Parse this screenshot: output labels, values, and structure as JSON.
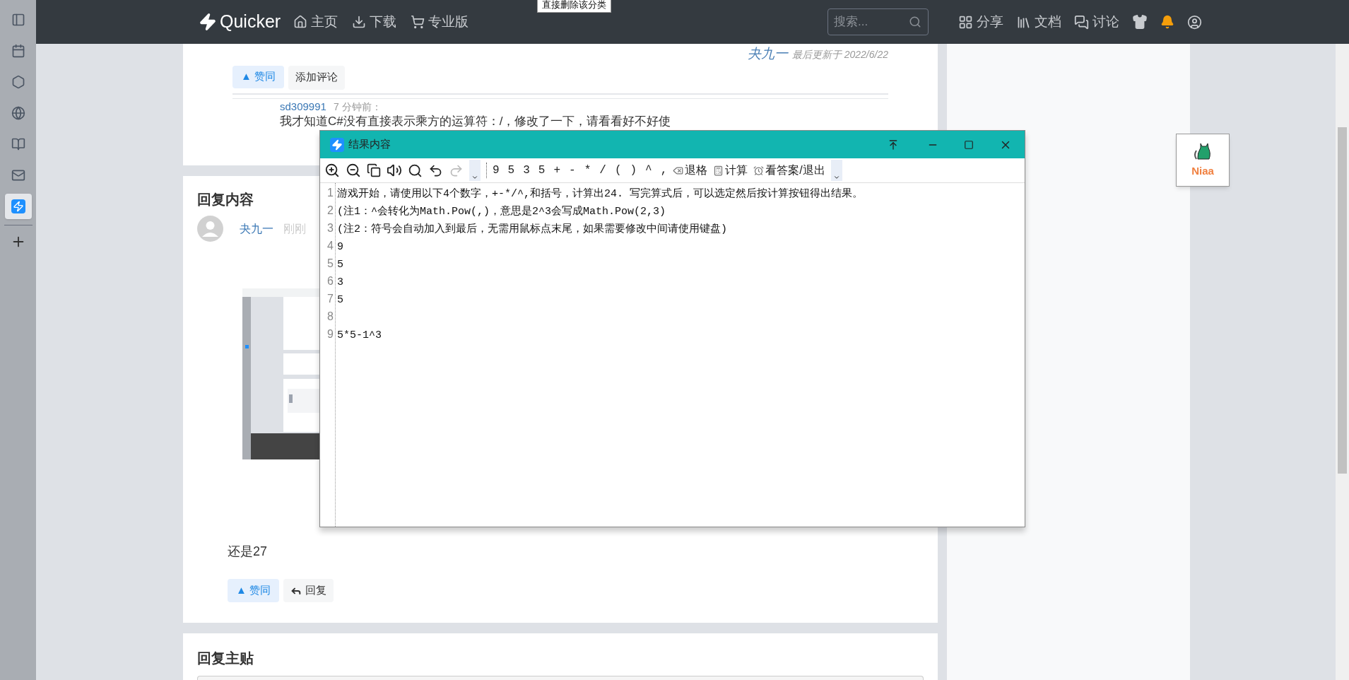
{
  "dock": {
    "items": [
      {
        "kind": "panel",
        "selected": false
      },
      {
        "kind": "calendar",
        "selected": false
      },
      {
        "kind": "hexagon",
        "selected": false
      },
      {
        "kind": "globe",
        "selected": false
      },
      {
        "kind": "book",
        "selected": false
      },
      {
        "kind": "mail",
        "selected": false
      },
      {
        "kind": "bolt",
        "selected": true
      }
    ]
  },
  "tooltip": "直接删除该分类",
  "navbar": {
    "brand": "Quicker",
    "links": [
      {
        "label": "主页",
        "kind": "home"
      },
      {
        "label": "下载",
        "kind": "download"
      },
      {
        "label": "专业版",
        "kind": "cart"
      }
    ],
    "search": {
      "placeholder": "搜索..."
    },
    "right_links": [
      {
        "label": "分享",
        "kind": "grid"
      },
      {
        "label": "文档",
        "kind": "library"
      },
      {
        "label": "讨论",
        "kind": "chat"
      }
    ]
  },
  "post_footer": {
    "author": "夬九一",
    "updated": "最后更新于 2022/6/22",
    "like": "▲ 赞同",
    "comment": "添加评论"
  },
  "comments": [
    {
      "user": "sd309991",
      "time": "7 分钟前：",
      "text": "我才知道C#没有直接表示乘方的运算符：/，修改了一下，请看看好不好使"
    }
  ],
  "reply_section": {
    "title": "回复内容",
    "author": "夬九一",
    "time": "刚刚",
    "text": "还是27",
    "like": "▲ 赞同",
    "reply": "回复"
  },
  "reply_main": {
    "title": "回复主贴"
  },
  "widget": {
    "label": "Niaa"
  },
  "result_window": {
    "title": "结果内容",
    "symbols": [
      "9",
      "5",
      "3",
      "5",
      "+",
      "-",
      "*",
      "/",
      "(",
      ")",
      "^",
      ","
    ],
    "actions": [
      {
        "label": "退格",
        "kind": "backspace"
      },
      {
        "label": "计算",
        "kind": "calc"
      },
      {
        "label": "看答案/退出",
        "kind": "answer"
      }
    ],
    "lines": [
      {
        "number": "1",
        "text": "游戏开始，请使用以下4个数字，+-*/^,和括号，计算出24. 写完算式后，可以选定然后按计算按钮得出结果。"
      },
      {
        "number": "2",
        "text": "(注1：^会转化为Math.Pow(,)，意思是2^3会写成Math.Pow(2,3)"
      },
      {
        "number": "3",
        "text": "(注2：符号会自动加入到最后，无需用鼠标点末尾，如果需要修改中间请使用键盘)"
      },
      {
        "number": "4",
        "text": "9"
      },
      {
        "number": "5",
        "text": "5"
      },
      {
        "number": "6",
        "text": "3"
      },
      {
        "number": "7",
        "text": "5"
      },
      {
        "number": "8"
      },
      {
        "number": "9",
        "text": "5*5-1^3"
      }
    ]
  }
}
